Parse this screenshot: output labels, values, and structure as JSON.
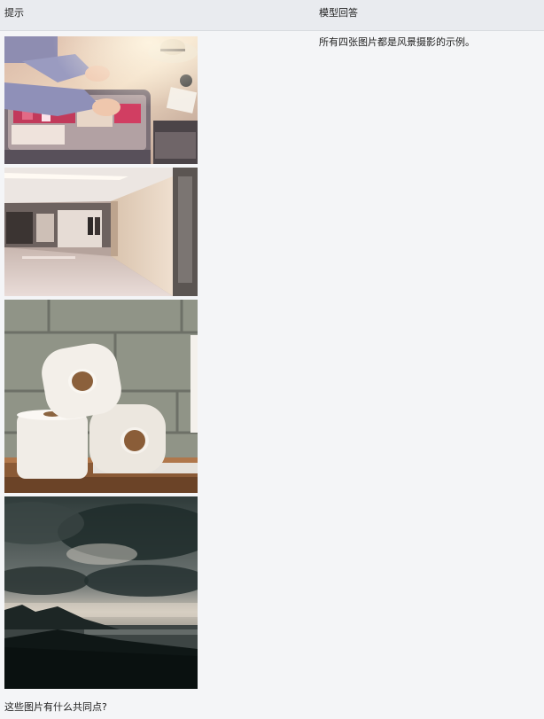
{
  "header": {
    "prompt_label": "提示",
    "answer_label": "模型回答"
  },
  "images": [
    {
      "icon": "suitcase-packing-photo"
    },
    {
      "icon": "shopping-mall-corridor-photo"
    },
    {
      "icon": "toilet-paper-rolls-photo"
    },
    {
      "icon": "stormy-sky-coast-photo"
    }
  ],
  "answer": {
    "text": "所有四张图片都是风景摄影的示例。"
  },
  "prompt": {
    "text": "这些图片有什么共同点?"
  },
  "colors": {
    "header_bg": "#e9ebef",
    "page_bg": "#f4f5f7",
    "text": "#222222"
  }
}
